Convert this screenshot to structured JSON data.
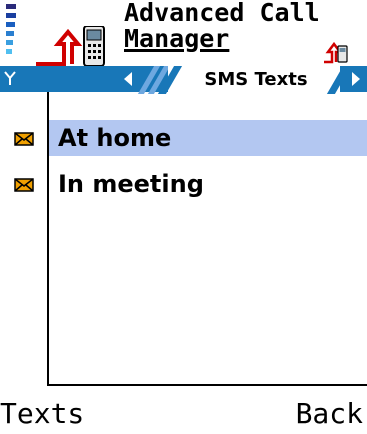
{
  "app": {
    "title_line1": "Advanced Call",
    "title_line2": "Manager"
  },
  "tabs": {
    "active_label": "SMS Texts"
  },
  "list": {
    "items": [
      {
        "label": "At home",
        "selected": true,
        "icon": "envelope-icon"
      },
      {
        "label": "In meeting",
        "selected": false,
        "icon": "envelope-icon"
      }
    ]
  },
  "softkeys": {
    "left": "Texts",
    "right": "Back"
  },
  "colors": {
    "accent": "#1877b8",
    "selection": "#b3c7f1",
    "envelope": "#f0a000"
  }
}
